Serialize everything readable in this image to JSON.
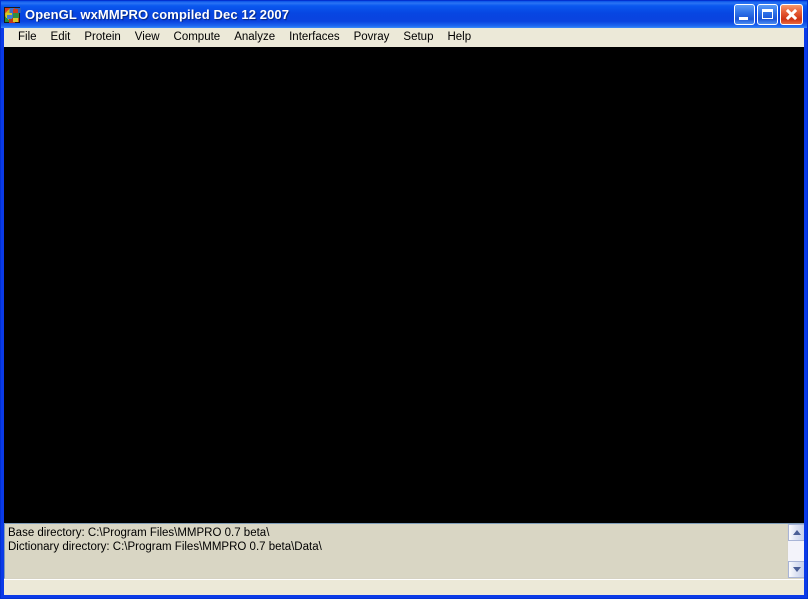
{
  "window": {
    "title": "OpenGL wxMMPRO compiled Dec 12 2007",
    "icon": "mosaic-blocks-icon",
    "frame_color": "#0a3ae8",
    "titlebar_gradient_from": "#2a74f4",
    "titlebar_gradient_to": "#0a43df",
    "controls": {
      "minimize_label": "",
      "maximize_label": "",
      "close_label": ""
    }
  },
  "menubar": {
    "items": [
      {
        "label": "File"
      },
      {
        "label": "Edit"
      },
      {
        "label": "Protein"
      },
      {
        "label": "View"
      },
      {
        "label": "Compute"
      },
      {
        "label": "Analyze"
      },
      {
        "label": "Interfaces"
      },
      {
        "label": "Povray"
      },
      {
        "label": "Setup"
      },
      {
        "label": "Help"
      }
    ]
  },
  "canvas": {
    "background_color": "#000000",
    "content": ""
  },
  "log": {
    "lines": [
      "Base directory: C:\\Program Files\\MMPRO 0.7 beta\\",
      "Dictionary directory: C:\\Program Files\\MMPRO 0.7 beta\\Data\\"
    ],
    "background_color": "#d9d6c4",
    "scrollbar": {
      "up_icon": "chevron-up-icon",
      "down_icon": "chevron-down-icon"
    }
  },
  "statusbar": {
    "text": ""
  }
}
